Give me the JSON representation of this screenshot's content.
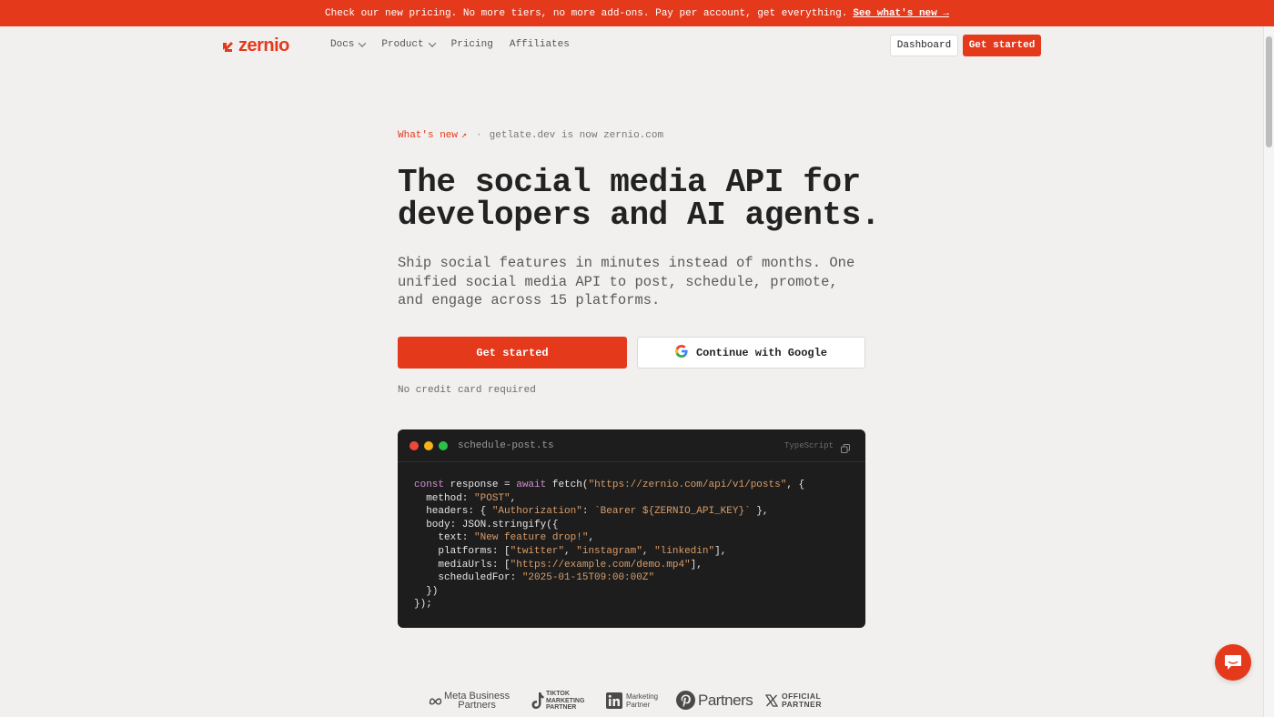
{
  "announcement": {
    "text": "Check our new pricing. No more tiers, no more add-ons. Pay per account, get everything.",
    "link": "See what's new →"
  },
  "nav": {
    "logo": "zernio",
    "items": [
      {
        "label": "Docs",
        "dropdown": true
      },
      {
        "label": "Product",
        "dropdown": true
      },
      {
        "label": "Pricing",
        "dropdown": false
      },
      {
        "label": "Affiliates",
        "dropdown": false
      }
    ],
    "dashboard": "Dashboard",
    "get_started": "Get started"
  },
  "hero": {
    "whats_new": "What's new",
    "whats_new_info": "getlate.dev is now zernio.com",
    "headline_1": "The social media API for",
    "headline_2": "developers and AI agents.",
    "subhead": "Ship social features in minutes instead of months. One unified social media API to post, schedule, promote, and engage across 15 platforms.",
    "cta_primary": "Get started",
    "cta_google": "Continue with Google",
    "note": "No credit card required"
  },
  "code": {
    "filename": "schedule-post.ts",
    "language": "TypeScript"
  },
  "partners": {
    "meta_1": "Meta Business",
    "meta_2": "Partners",
    "tiktok_1": "TIKTOK",
    "tiktok_2": "MARKETING",
    "tiktok_3": "PARTNER",
    "linkedin_1": "Marketing",
    "linkedin_2": "Partner",
    "pinterest": "Partners",
    "x_1": "OFFICIAL",
    "x_2": "PARTNER"
  },
  "colors": {
    "accent": "#e5391c",
    "background": "#f1f0ee",
    "code_bg": "#1d1d1d"
  }
}
